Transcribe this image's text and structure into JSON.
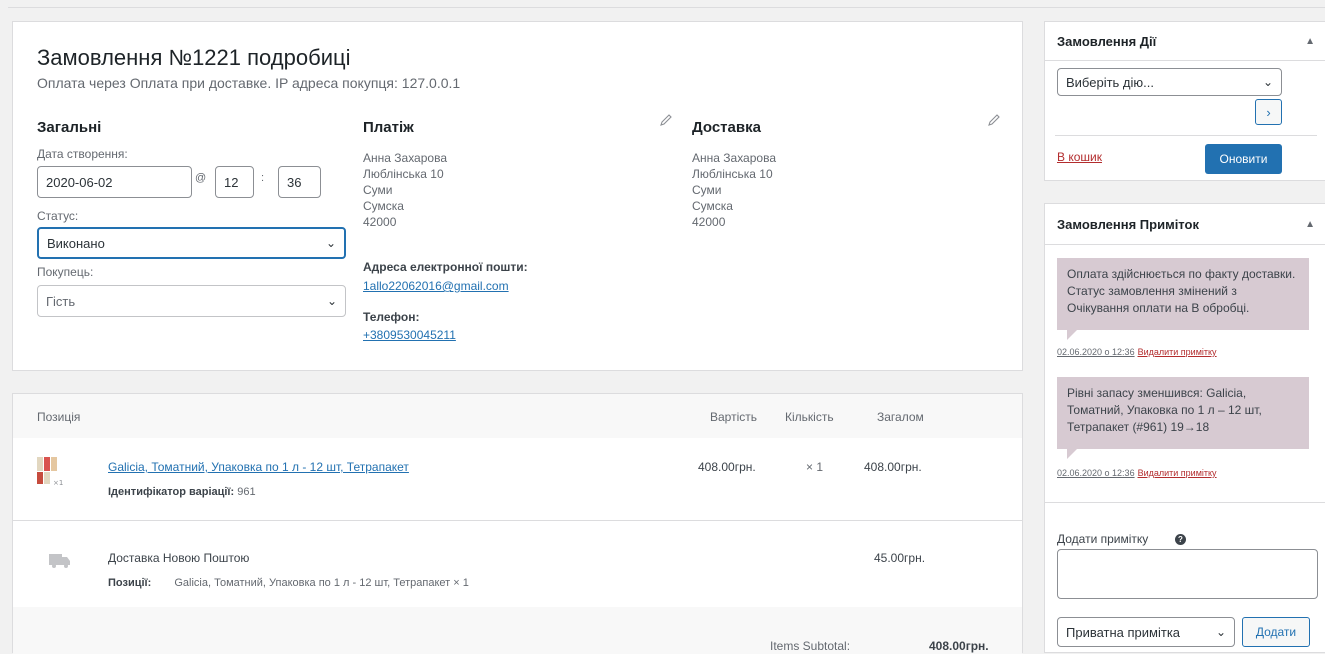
{
  "order": {
    "title": "Замовлення №1221 подробиці",
    "subtitle": "Оплата через Оплата при доставке. IP адреса покупця: 127.0.0.1",
    "general": {
      "heading": "Загальні",
      "date_label": "Дата створення:",
      "date_value": "2020-06-02",
      "at": "@",
      "hour": "12",
      "colon": ":",
      "minute": "36",
      "status_label": "Статус:",
      "status_value": "Виконано",
      "customer_label": "Покупець:",
      "customer_value": "Гість"
    },
    "billing": {
      "heading": "Платіж",
      "name": "Анна Захарова",
      "street": "Люблінська 10",
      "city": "Суми",
      "region": "Сумска",
      "postcode": "42000",
      "email_label": "Адреса електронної пошти:",
      "email": "1allo22062016@gmail.com",
      "phone_label": "Телефон:",
      "phone": "+3809530045211"
    },
    "shipping": {
      "heading": "Доставка",
      "name": "Анна Захарова",
      "street": "Люблінська 10",
      "city": "Суми",
      "region": "Сумска",
      "postcode": "42000"
    }
  },
  "items": {
    "headers": {
      "item": "Позиція",
      "cost": "Вартість",
      "qty": "Кількість",
      "total": "Загалом"
    },
    "line": {
      "name": "Galicia, Томатний, Упаковка по 1 л - 12 шт, Тетрапакет",
      "variation_label": "Ідентифікатор варіації:",
      "variation_id": "961",
      "cost": "408.00грн.",
      "qty": "× 1",
      "total": "408.00грн.",
      "thumb_badge": "×12"
    },
    "shipping": {
      "name": "Доставка Новою Поштою",
      "items_label": "Позиції:",
      "items_value": "Galicia, Томатний, Упаковка по 1 л - 12 шт, Тетрапакет × 1",
      "total": "45.00грн."
    },
    "subtotal_label": "Items Subtotal:",
    "subtotal_value": "408.00грн."
  },
  "actions": {
    "title": "Замовлення Дії",
    "select_placeholder": "Виберіть дію...",
    "go": "›",
    "trash": "В кошик",
    "update": "Оновити"
  },
  "notes": {
    "title": "Замовлення Приміток",
    "list": [
      {
        "text": "Оплата здійснюється по факту доставки. Статус замовлення змінений з Очікування оплати на В обробці.",
        "date": "02.06.2020 о 12:36",
        "delete": "Видалити примітку"
      },
      {
        "text": "Рівні запасу зменшився: Galicia, Томатний, Упаковка по 1 л – 12 шт, Тетрапакет (#961) 19→18",
        "date": "02.06.2020 о 12:36",
        "delete": "Видалити примітку"
      }
    ],
    "add_label": "Додати примітку",
    "help": "?",
    "type_value": "Приватна примітка",
    "add_button": "Додати"
  },
  "colors": {
    "accent": "#2271b1",
    "note_bg": "#d7cad2",
    "delete": "#b32d2e"
  }
}
